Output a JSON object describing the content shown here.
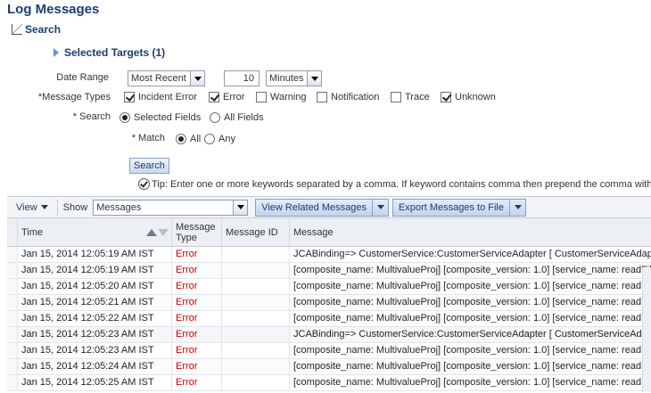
{
  "page": {
    "title": "Log Messages"
  },
  "search": {
    "header": "Search",
    "targets": "Selected Targets (1)",
    "date_range_label": "Date Range",
    "date_range_value": "Most Recent",
    "date_amount": "10",
    "date_unit": "Minutes",
    "message_types_label": "*Message Types",
    "message_types": [
      {
        "label": "Incident Error",
        "checked": true
      },
      {
        "label": "Error",
        "checked": true
      },
      {
        "label": "Warning",
        "checked": false
      },
      {
        "label": "Notification",
        "checked": false
      },
      {
        "label": "Trace",
        "checked": false
      },
      {
        "label": "Unknown",
        "checked": true
      }
    ],
    "search_label": "* Search",
    "search_options": [
      "Selected Fields",
      "All Fields"
    ],
    "match_label": "* Match",
    "match_options": [
      "All",
      "Any"
    ],
    "search_button": "Search",
    "tip": "Tip: Enter one or more keywords separated by a comma. If keyword contains comma then prepend the comma with 'V"
  },
  "toolbar": {
    "view_label": "View",
    "show_label": "Show",
    "show_value": "Messages",
    "view_related": "View Related Messages",
    "export": "Export Messages to File"
  },
  "table": {
    "columns": [
      "Time",
      "Message Type",
      "Message ID",
      "Message"
    ],
    "rows": [
      {
        "time": "Jan 15, 2014 12:05:19 AM IST",
        "type": "Error",
        "id": "",
        "message": "JCABinding=> CustomerService:CustomerServiceAdapter [ CustomerServiceAdapter_"
      },
      {
        "time": "Jan 15, 2014 12:05:19 AM IST",
        "type": "Error",
        "id": "",
        "message": "[composite_name: MultivalueProj] [composite_version: 1.0] [service_name: readFile]."
      },
      {
        "time": "Jan 15, 2014 12:05:20 AM IST",
        "type": "Error",
        "id": "",
        "message": "[composite_name: MultivalueProj] [composite_version: 1.0] [service_name: readFile]."
      },
      {
        "time": "Jan 15, 2014 12:05:21 AM IST",
        "type": "Error",
        "id": "",
        "message": "[composite_name: MultivalueProj] [composite_version: 1.0] [service_name: readFile]."
      },
      {
        "time": "Jan 15, 2014 12:05:22 AM IST",
        "type": "Error",
        "id": "",
        "message": "[composite_name: MultivalueProj] [composite_version: 1.0] [service_name: readFile]."
      },
      {
        "time": "Jan 15, 2014 12:05:23 AM IST",
        "type": "Error",
        "id": "",
        "message": "JCABinding=> CustomerService:CustomerServiceAdapter [ CustomerServiceAdapter_"
      },
      {
        "time": "Jan 15, 2014 12:05:23 AM IST",
        "type": "Error",
        "id": "",
        "message": "[composite_name: MultivalueProj] [composite_version: 1.0] [service_name: readFile]."
      },
      {
        "time": "Jan 15, 2014 12:05:24 AM IST",
        "type": "Error",
        "id": "",
        "message": "[composite_name: MultivalueProj] [composite_version: 1.0] [service_name: readFile]."
      },
      {
        "time": "Jan 15, 2014 12:05:25 AM IST",
        "type": "Error",
        "id": "",
        "message": "[composite_name: MultivalueProj] [composite_version: 1.0] [service_name: readFile]."
      }
    ]
  },
  "colors": {
    "title": "#1c3d6e",
    "error": "#cc0000",
    "button": "#c3d4ec"
  }
}
